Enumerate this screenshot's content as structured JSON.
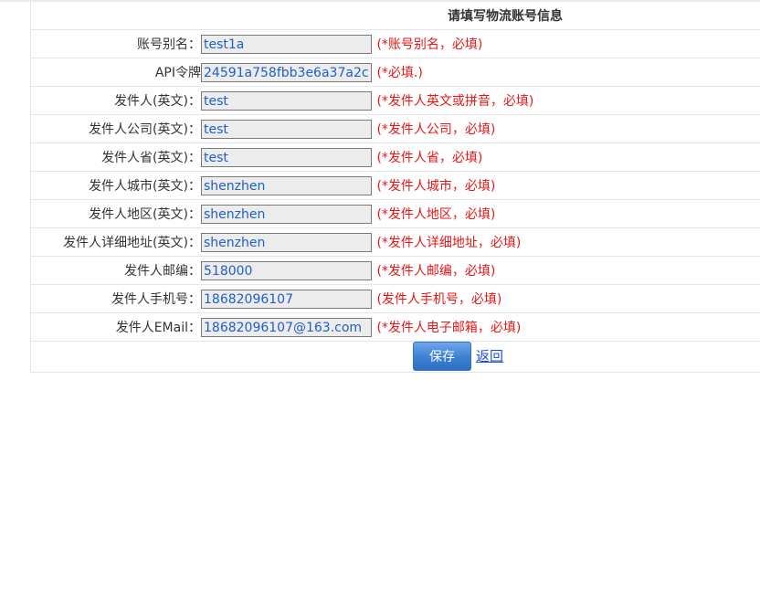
{
  "form": {
    "title": "请填写物流账号信息",
    "fields": [
      {
        "label": "账号别名：",
        "value": "test1a",
        "hint": "(*账号别名，必填)"
      },
      {
        "label": "API令牌",
        "value": "24591a758fbb3e6a37a2c",
        "hint": "(*必填.)"
      },
      {
        "label": "发件人(英文)：",
        "value": "test",
        "hint": "(*发件人英文或拼音，必填)"
      },
      {
        "label": "发件人公司(英文)：",
        "value": "test",
        "hint": "(*发件人公司，必填)"
      },
      {
        "label": "发件人省(英文)：",
        "value": "test",
        "hint": "(*发件人省，必填)"
      },
      {
        "label": "发件人城市(英文)：",
        "value": "shenzhen",
        "hint": "(*发件人城市，必填)"
      },
      {
        "label": "发件人地区(英文)：",
        "value": "shenzhen",
        "hint": "(*发件人地区，必填)"
      },
      {
        "label": "发件人详细地址(英文)：",
        "value": "shenzhen",
        "hint": "(*发件人详细地址，必填)"
      },
      {
        "label": "发件人邮编：",
        "value": "518000",
        "hint": "(*发件人邮编，必填)"
      },
      {
        "label": "发件人手机号：",
        "value": "18682096107",
        "hint": "(发件人手机号，必填)"
      },
      {
        "label": "发件人EMail：",
        "value": "18682096107@163.com",
        "hint": "(*发件人电子邮箱，必填)"
      }
    ],
    "save_label": "保存",
    "back_label": "返回"
  },
  "colors": {
    "hint": "#e81616",
    "input_text": "#1f5fc6",
    "button": "#3c7fd3",
    "link": "#1a4fd6"
  }
}
